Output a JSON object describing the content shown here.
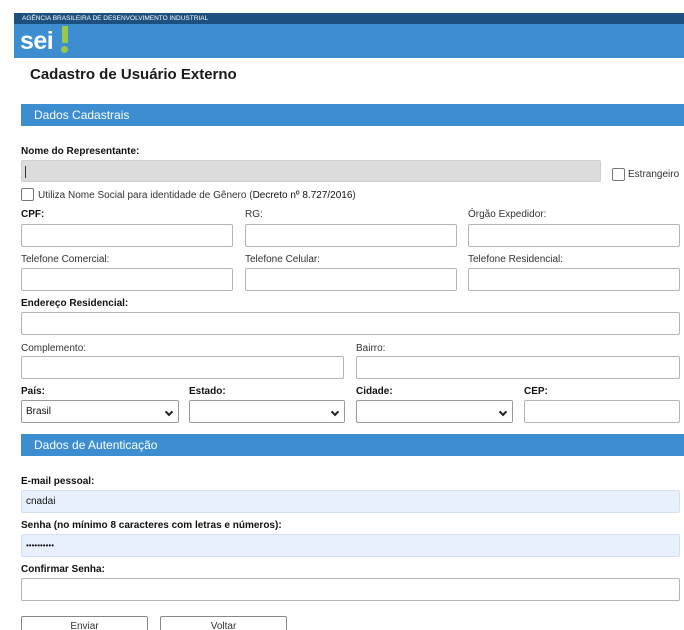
{
  "header": {
    "agency": "AGÊNCIA BRASILEIRA DE DESENVOLVIMENTO INDUSTRIAL",
    "logo": "sei"
  },
  "page": {
    "title": "Cadastro de Usuário Externo"
  },
  "sections": {
    "dados_cadastrais": "Dados Cadastrais",
    "dados_autenticacao": "Dados de Autenticação"
  },
  "fields": {
    "nome_representante": {
      "label": "Nome do Representante:",
      "value": ""
    },
    "estrangeiro": {
      "label": "Estrangeiro"
    },
    "nome_social": {
      "label": "Utiliza Nome Social para identidade de Gênero (",
      "link": "Decreto nº 8.727/2016",
      "suffix": ")"
    },
    "cpf": {
      "label": "CPF:"
    },
    "rg": {
      "label": "RG:"
    },
    "orgao_expedidor": {
      "label": "Órgão Expedidor:"
    },
    "telefone_comercial": {
      "label": "Telefone Comercial:"
    },
    "telefone_celular": {
      "label": "Telefone Celular:"
    },
    "telefone_residencial": {
      "label": "Telefone Residencial:"
    },
    "endereco_residencial": {
      "label": "Endereço Residencial:"
    },
    "complemento": {
      "label": "Complemento:"
    },
    "bairro": {
      "label": "Bairro:"
    },
    "pais": {
      "label": "País:",
      "selected": "Brasil"
    },
    "estado": {
      "label": "Estado:",
      "selected": ""
    },
    "cidade": {
      "label": "Cidade:",
      "selected": ""
    },
    "cep": {
      "label": "CEP:"
    },
    "email": {
      "label": "E-mail pessoal:",
      "value": "cnadai"
    },
    "senha": {
      "label": "Senha (no mínimo 8 caracteres com letras e números):",
      "value": "••••••••••"
    },
    "confirmar_senha": {
      "label": "Confirmar Senha:",
      "value": ""
    }
  },
  "buttons": {
    "enviar": "Enviar",
    "voltar": "Voltar"
  },
  "colors": {
    "header_blue": "#3c8ed1",
    "agency_strip": "#1d4f7f",
    "logo_accent": "#9ac84d",
    "autofill": "#e8f0fe"
  }
}
